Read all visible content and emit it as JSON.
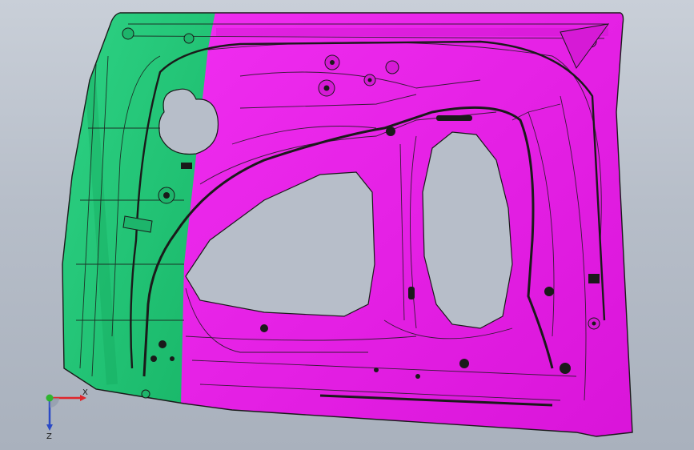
{
  "viewport": {
    "background_top": "#c9cfd8",
    "background_bottom": "#a9b1bd"
  },
  "model": {
    "part_name": "door-inner-panel",
    "colors": {
      "green_region": "#21c877",
      "magenta_region": "#e81ee8",
      "edge_lines": "#1a1a1a",
      "cutout": "#b7bec9"
    }
  },
  "triad": {
    "x_label": "X",
    "z_label": "Z",
    "x_color": "#e0262b",
    "y_color": "#2fb52f",
    "z_color": "#2a49c6"
  }
}
